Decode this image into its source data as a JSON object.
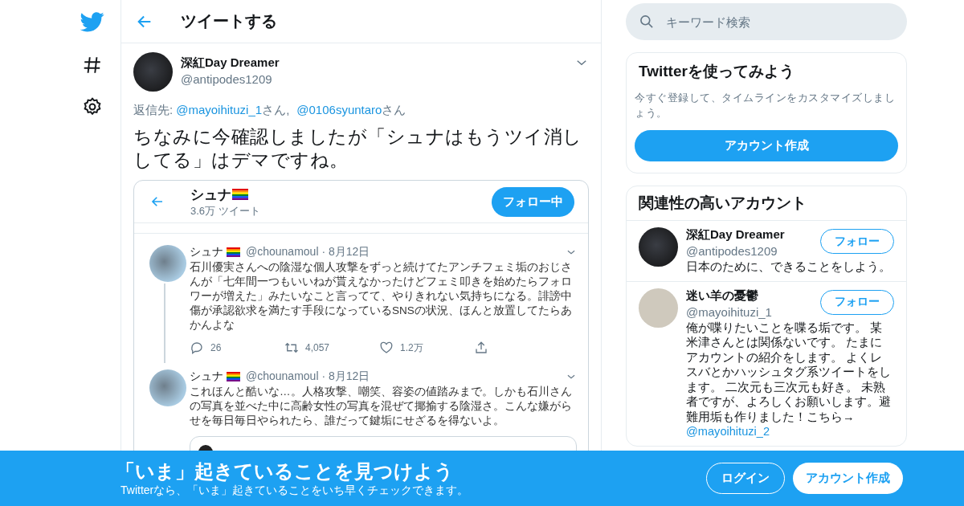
{
  "header": {
    "title": "ツイートする"
  },
  "tweet": {
    "author": "深紅Day Dreamer",
    "handle": "@antipodes1209",
    "reply_prefix": "返信先:",
    "reply_to": [
      {
        "handle": "@mayoihituzi_1",
        "suffix": "さん"
      },
      {
        "handle": "@0106syuntaro",
        "suffix": "さん"
      }
    ],
    "separator": ",",
    "text": "ちなみに今確認しましたが「シュナはもうツイ消ししてる」はデマですね。"
  },
  "embedded_screenshot": {
    "profile_name": "シュナ",
    "tweet_count": "3.6万 ツイート",
    "follow_button": "フォロー中",
    "tweets": [
      {
        "name": "シュナ",
        "meta": "@chounamoul · 8月12日",
        "text": "石川優実さんへの陰湿な個人攻撃をずっと続けてたアンチフェミ垢のおじさんが「七年間一つもいいねが貰えなかったけどフェミ叩きを始めたらフォロワーが増えた」みたいなこと言ってて、やりきれない気持ちになる。誹謗中傷が承認欲求を満たす手段になっているSNSの状況、ほんと放置してたらあかんよな",
        "kind": "with_actions",
        "actions": [
          {
            "kind": "reply",
            "count": "26"
          },
          {
            "kind": "retweet",
            "count": "4,057"
          },
          {
            "kind": "like",
            "count": "1.2万"
          },
          {
            "kind": "share"
          }
        ]
      },
      {
        "name": "シュナ",
        "meta": "@chounamoul · 8月12日",
        "text": "これほんと酷いな…。人格攻撃、嘲笑、容姿の値踏みまで。しかも石川さんの写真を並べた中に高齢女性の写真を混ぜて揶揄する陰湿さ。こんな嫌がらせを毎日毎日やられたら、誰だって鍵垢にせざるを得ないよ。",
        "kind": "with_quote"
      }
    ]
  },
  "search": {
    "placeholder": "キーワード検索"
  },
  "signup_card": {
    "title": "Twitterを使ってみよう",
    "text": "今すぐ登録して、タイムラインをカスタマイズしましょう。",
    "button": "アカウント作成"
  },
  "related": {
    "title": "関連性の高いアカウント",
    "accounts": [
      {
        "name": "深紅Day Dreamer",
        "handle": "@antipodes1209",
        "button": "フォロー",
        "bio": "日本のために、できることをしよう。"
      },
      {
        "name": "迷い羊の憂鬱",
        "handle": "@mayoihituzi_1",
        "button": "フォロー",
        "bio": "俺が喋りたいことを喋る垢です。 某米津さんとは関係ないです。 たまにアカウントの紹介をします。 よくレスバとかハッシュタグ系ツイートをします。 二次元も三次元も好き。 未熟者ですが、よろしくお願いします。避難用垢も作りました！こちら→",
        "bio_link": "@mayoihituzi_2"
      }
    ]
  },
  "banner": {
    "title": "「いま」起きていることを見つけよう",
    "subtitle": "Twitterなら、「いま」起きていることをいち早くチェックできます。",
    "login_button": "ログイン",
    "signup_button": "アカウント作成"
  }
}
